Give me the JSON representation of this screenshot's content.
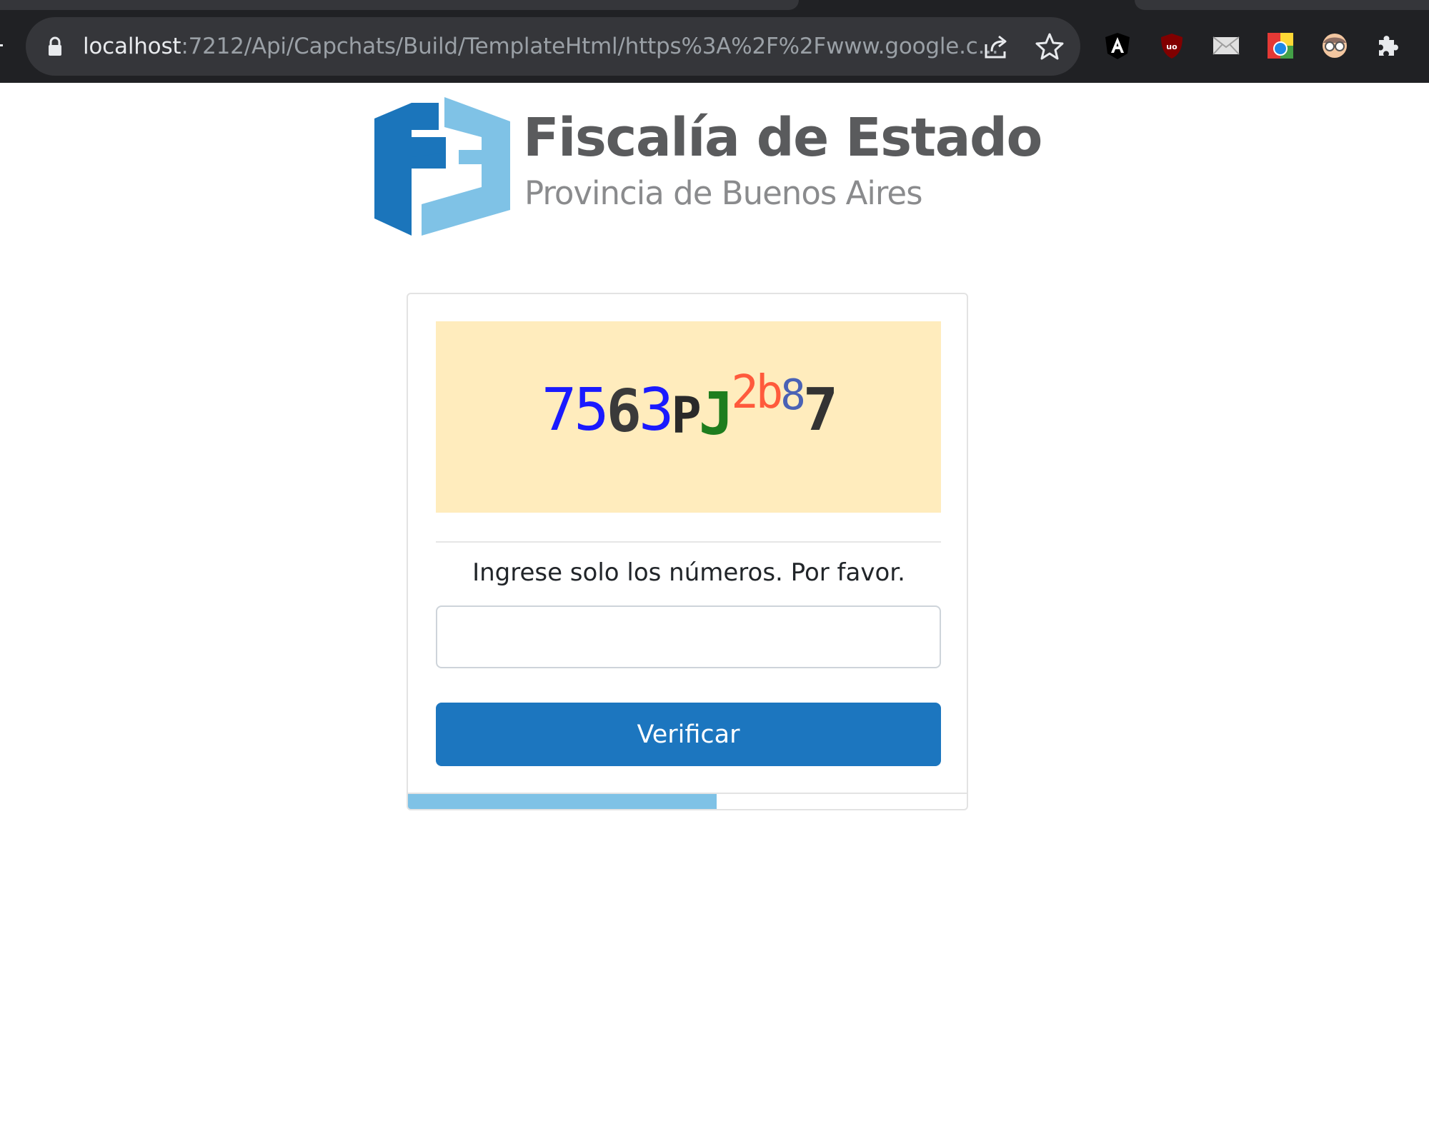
{
  "browser": {
    "url_host": "localhost",
    "url_rest": ":7212/Api/Capchats/Build/TemplateHtml/https%3A%2F%2Fwww.google.c...",
    "icons": [
      "lock-icon",
      "share-icon",
      "star-icon",
      "angular-extension-icon",
      "ublock-extension-icon",
      "mail-extension-icon",
      "color-picker-extension-icon",
      "reader-extension-icon",
      "extensions-puzzle-icon"
    ]
  },
  "brand": {
    "title": "Fiscalía de Estado",
    "subtitle": "Provincia de Buenos Aires",
    "colors": {
      "dark_blue": "#1b75bb",
      "light_blue": "#7fc2e6",
      "gray": "#5a5b5d"
    }
  },
  "captcha": {
    "background": "#ffecbd",
    "chars": [
      {
        "ch": "7",
        "color": "#1a1aff"
      },
      {
        "ch": "5",
        "color": "#1a1aff"
      },
      {
        "ch": "6",
        "color": "#3a3a3a"
      },
      {
        "ch": "3",
        "color": "#1a1aff"
      },
      {
        "ch": "P",
        "color": "#2a2a2a"
      },
      {
        "ch": "J",
        "color": "#1e7d1e"
      },
      {
        "ch": "2",
        "color": "#ff5a3c"
      },
      {
        "ch": "b",
        "color": "#ff5a3c"
      },
      {
        "ch": "8",
        "color": "#4a62b5"
      },
      {
        "ch": "7",
        "color": "#333333"
      }
    ]
  },
  "form": {
    "instruction": "Ingrese solo los números. Por favor.",
    "input_value": "",
    "button_label": "Verificar",
    "button_color": "#1c76bf"
  },
  "progress": {
    "fraction": 0.55,
    "color": "#7fc2e6"
  }
}
